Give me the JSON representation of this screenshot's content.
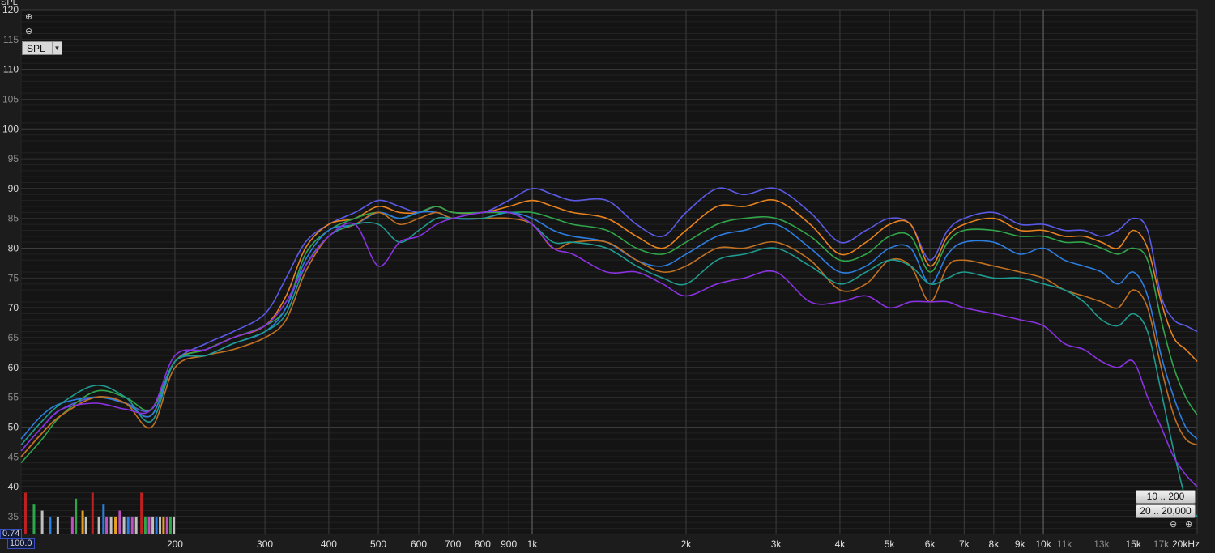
{
  "toolbar": {
    "yaxis_title": "SPL",
    "spl_select": "SPL",
    "range_freq": "10 .. 200",
    "range_span": "20 .. 20,000",
    "cursor_value": "0.74",
    "cursor_freq": "100.0",
    "zoom_in_icon": "zoom-in-icon",
    "zoom_out_icon": "zoom-out-icon"
  },
  "colors": {
    "background": "#1c1c1c",
    "plot_background": "#141414",
    "grid_major": "#3a3a3a",
    "grid_minor": "#262626"
  },
  "chart_data": {
    "type": "line",
    "title": "",
    "xlabel": "",
    "ylabel": "SPL",
    "x_scale": "log",
    "xlim": [
      100,
      20000
    ],
    "ylim": [
      32,
      120
    ],
    "grid": true,
    "legend": "none",
    "y_ticks": [
      {
        "v": 120,
        "label": "120",
        "major": true
      },
      {
        "v": 115,
        "label": "115",
        "major": false
      },
      {
        "v": 110,
        "label": "110",
        "major": true
      },
      {
        "v": 105,
        "label": "105",
        "major": false
      },
      {
        "v": 100,
        "label": "100",
        "major": true
      },
      {
        "v": 95,
        "label": "95",
        "major": false
      },
      {
        "v": 90,
        "label": "90",
        "major": true
      },
      {
        "v": 85,
        "label": "85",
        "major": false
      },
      {
        "v": 80,
        "label": "80",
        "major": true
      },
      {
        "v": 75,
        "label": "75",
        "major": false
      },
      {
        "v": 70,
        "label": "70",
        "major": true
      },
      {
        "v": 65,
        "label": "65",
        "major": false
      },
      {
        "v": 60,
        "label": "60",
        "major": true
      },
      {
        "v": 55,
        "label": "55",
        "major": false
      },
      {
        "v": 50,
        "label": "50",
        "major": true
      },
      {
        "v": 45,
        "label": "45",
        "major": false
      },
      {
        "v": 40,
        "label": "40",
        "major": true
      },
      {
        "v": 35,
        "label": "35",
        "major": false
      }
    ],
    "x_ticks": [
      {
        "v": 200,
        "label": "200",
        "major": true
      },
      {
        "v": 300,
        "label": "300",
        "major": true
      },
      {
        "v": 400,
        "label": "400",
        "major": true
      },
      {
        "v": 500,
        "label": "500",
        "major": true
      },
      {
        "v": 600,
        "label": "600",
        "major": true
      },
      {
        "v": 700,
        "label": "700",
        "major": true
      },
      {
        "v": 800,
        "label": "800",
        "major": true
      },
      {
        "v": 900,
        "label": "900",
        "major": true
      },
      {
        "v": 1000,
        "label": "1k",
        "major": true
      },
      {
        "v": 2000,
        "label": "2k",
        "major": true
      },
      {
        "v": 3000,
        "label": "3k",
        "major": true
      },
      {
        "v": 4000,
        "label": "4k",
        "major": true
      },
      {
        "v": 5000,
        "label": "5k",
        "major": true
      },
      {
        "v": 6000,
        "label": "6k",
        "major": true
      },
      {
        "v": 7000,
        "label": "7k",
        "major": true
      },
      {
        "v": 8000,
        "label": "8k",
        "major": true
      },
      {
        "v": 9000,
        "label": "9k",
        "major": true
      },
      {
        "v": 10000,
        "label": "10k",
        "major": true
      },
      {
        "v": 11000,
        "label": "11k",
        "major": false
      },
      {
        "v": 13000,
        "label": "13k",
        "major": false
      },
      {
        "v": 15000,
        "label": "15k",
        "major": true
      },
      {
        "v": 17000,
        "label": "17k",
        "major": false
      },
      {
        "v": 20000,
        "label": "20kHz",
        "major": true
      }
    ],
    "series": [
      {
        "color": "#5a5ae6",
        "x": [
          100,
          110,
          120,
          140,
          160,
          180,
          200,
          230,
          260,
          300,
          330,
          360,
          400,
          450,
          500,
          550,
          600,
          650,
          700,
          800,
          900,
          1000,
          1100,
          1200,
          1400,
          1600,
          1800,
          2000,
          2300,
          2600,
          3000,
          3500,
          4000,
          4500,
          5000,
          5500,
          6000,
          6500,
          7000,
          8000,
          9000,
          10000,
          11000,
          12000,
          13000,
          14000,
          15000,
          16000,
          17000,
          18000,
          19000,
          20000
        ],
        "y": [
          46,
          50,
          53,
          55,
          54,
          53,
          61,
          64,
          66,
          69,
          75,
          81,
          84,
          86,
          88,
          87,
          86,
          87,
          86,
          86,
          88,
          90,
          89,
          88,
          88,
          84,
          82,
          86,
          90,
          89,
          90,
          86,
          81,
          83,
          85,
          84,
          78,
          83,
          85,
          86,
          84,
          84,
          83,
          83,
          82,
          83,
          85,
          83,
          72,
          68,
          67,
          66
        ]
      },
      {
        "color": "#e8821e",
        "x": [
          100,
          110,
          120,
          140,
          160,
          180,
          200,
          230,
          260,
          300,
          330,
          360,
          400,
          450,
          500,
          550,
          600,
          650,
          700,
          800,
          900,
          1000,
          1100,
          1200,
          1400,
          1600,
          1800,
          2000,
          2300,
          2600,
          3000,
          3500,
          4000,
          4500,
          5000,
          5500,
          6000,
          6500,
          7000,
          8000,
          9000,
          10000,
          11000,
          12000,
          13000,
          14000,
          15000,
          16000,
          17000,
          18000,
          19000,
          20000
        ],
        "y": [
          45,
          49,
          52,
          55,
          54,
          52,
          61,
          63,
          65,
          67,
          72,
          80,
          84,
          85,
          87,
          86,
          86,
          87,
          86,
          86,
          87,
          88,
          87,
          86,
          85,
          82,
          80,
          83,
          87,
          87,
          88,
          84,
          79,
          81,
          84,
          84,
          77,
          82,
          84,
          85,
          83,
          83,
          82,
          82,
          81,
          80,
          83,
          80,
          71,
          65,
          63,
          61
        ]
      },
      {
        "color": "#2fa64a",
        "x": [
          100,
          110,
          120,
          140,
          160,
          180,
          200,
          230,
          260,
          300,
          330,
          360,
          400,
          450,
          500,
          550,
          600,
          650,
          700,
          800,
          900,
          1000,
          1100,
          1200,
          1400,
          1600,
          1800,
          2000,
          2300,
          2600,
          3000,
          3500,
          4000,
          4500,
          5000,
          5500,
          6000,
          6500,
          7000,
          8000,
          9000,
          10000,
          11000,
          12000,
          13000,
          14000,
          15000,
          16000,
          17000,
          18000,
          19000,
          20000
        ],
        "y": [
          44,
          48,
          52,
          56,
          55,
          53,
          61,
          63,
          65,
          67,
          70,
          79,
          83,
          85,
          86,
          85,
          86,
          87,
          86,
          86,
          86,
          86,
          85,
          84,
          83,
          80,
          79,
          81,
          84,
          85,
          85,
          82,
          78,
          79,
          82,
          82,
          76,
          81,
          83,
          83,
          82,
          82,
          81,
          81,
          80,
          79,
          80,
          78,
          68,
          60,
          55,
          52
        ]
      },
      {
        "color": "#2c7ee0",
        "x": [
          100,
          110,
          120,
          140,
          160,
          180,
          200,
          230,
          260,
          300,
          330,
          360,
          400,
          450,
          500,
          550,
          600,
          650,
          700,
          800,
          900,
          1000,
          1100,
          1200,
          1400,
          1600,
          1800,
          2000,
          2300,
          2600,
          3000,
          3500,
          4000,
          4500,
          5000,
          5500,
          6000,
          6500,
          7000,
          8000,
          9000,
          10000,
          11000,
          12000,
          13000,
          14000,
          15000,
          16000,
          17000,
          18000,
          19000,
          20000
        ],
        "y": [
          48,
          52,
          54,
          55,
          54,
          52,
          61,
          62,
          64,
          66,
          70,
          78,
          83,
          84,
          86,
          85,
          86,
          86,
          85,
          85,
          86,
          85,
          83,
          82,
          81,
          78,
          77,
          79,
          82,
          83,
          84,
          80,
          76,
          77,
          80,
          80,
          74,
          79,
          81,
          81,
          79,
          80,
          78,
          77,
          76,
          74,
          76,
          72,
          62,
          55,
          50,
          48
        ]
      },
      {
        "color": "#c07020",
        "x": [
          100,
          110,
          120,
          140,
          160,
          180,
          200,
          230,
          260,
          300,
          330,
          360,
          400,
          450,
          500,
          550,
          600,
          650,
          700,
          800,
          900,
          1000,
          1100,
          1200,
          1400,
          1600,
          1800,
          2000,
          2300,
          2600,
          3000,
          3500,
          4000,
          4500,
          5000,
          5500,
          6000,
          6500,
          7000,
          8000,
          9000,
          10000,
          11000,
          12000,
          13000,
          14000,
          15000,
          16000,
          17000,
          18000,
          19000,
          20000
        ],
        "y": [
          45,
          49,
          52,
          55,
          54,
          50,
          60,
          62,
          63,
          65,
          68,
          76,
          82,
          84,
          86,
          84,
          85,
          86,
          85,
          85,
          85,
          84,
          80,
          81,
          81,
          78,
          76,
          77,
          80,
          80,
          81,
          78,
          73,
          74,
          78,
          77,
          71,
          77,
          78,
          77,
          76,
          75,
          73,
          72,
          71,
          70,
          73,
          70,
          60,
          52,
          48,
          47
        ]
      },
      {
        "color": "#1f9b8f",
        "x": [
          100,
          110,
          120,
          140,
          160,
          180,
          200,
          230,
          260,
          300,
          330,
          360,
          400,
          450,
          500,
          550,
          600,
          650,
          700,
          800,
          900,
          1000,
          1100,
          1200,
          1400,
          1600,
          1800,
          2000,
          2300,
          2600,
          3000,
          3500,
          4000,
          4500,
          5000,
          5500,
          6000,
          6500,
          7000,
          8000,
          9000,
          10000,
          11000,
          12000,
          13000,
          14000,
          15000,
          16000,
          17000,
          18000,
          19000,
          20000
        ],
        "y": [
          47,
          51,
          54,
          57,
          55,
          51,
          61,
          62,
          64,
          66,
          69,
          77,
          82,
          84,
          84,
          81,
          83,
          85,
          85,
          85,
          86,
          84,
          81,
          81,
          80,
          77,
          75,
          74,
          78,
          79,
          80,
          77,
          74,
          76,
          78,
          77,
          74,
          75,
          76,
          75,
          75,
          74,
          73,
          71,
          68,
          67,
          69,
          66,
          56,
          46,
          38,
          35
        ]
      },
      {
        "color": "#8a32e0",
        "x": [
          100,
          110,
          120,
          140,
          160,
          180,
          200,
          230,
          260,
          300,
          330,
          360,
          400,
          450,
          500,
          550,
          600,
          650,
          700,
          800,
          900,
          1000,
          1100,
          1200,
          1400,
          1600,
          1800,
          2000,
          2300,
          2600,
          3000,
          3500,
          4000,
          4500,
          5000,
          5500,
          6000,
          6500,
          7000,
          8000,
          9000,
          10000,
          11000,
          12000,
          13000,
          14000,
          15000,
          16000,
          17000,
          18000,
          19000,
          20000
        ],
        "y": [
          46,
          50,
          53,
          54,
          53,
          53,
          62,
          63,
          65,
          67,
          71,
          77,
          82,
          84,
          77,
          81,
          82,
          84,
          85,
          86,
          86,
          84,
          80,
          79,
          76,
          76,
          74,
          72,
          74,
          75,
          76,
          71,
          71,
          72,
          70,
          71,
          71,
          71,
          70,
          69,
          68,
          67,
          64,
          63,
          61,
          60,
          61,
          55,
          50,
          45,
          42,
          40
        ]
      }
    ],
    "bars_note": "",
    "bars": [
      {
        "x": 102,
        "h": 39,
        "color": "#c02020"
      },
      {
        "x": 106,
        "h": 37,
        "color": "#2fa64a"
      },
      {
        "x": 110,
        "h": 36,
        "color": "#c0c0c0"
      },
      {
        "x": 114,
        "h": 35,
        "color": "#2c7ee0"
      },
      {
        "x": 118,
        "h": 35,
        "color": "#c0c0c0"
      },
      {
        "x": 126,
        "h": 35,
        "color": "#c050c0"
      },
      {
        "x": 128,
        "h": 38,
        "color": "#2fa64a"
      },
      {
        "x": 132,
        "h": 36,
        "color": "#e8a020"
      },
      {
        "x": 134,
        "h": 35,
        "color": "#c0c0c0"
      },
      {
        "x": 138,
        "h": 39,
        "color": "#c02020"
      },
      {
        "x": 142,
        "h": 35,
        "color": "#c0c0c0"
      },
      {
        "x": 145,
        "h": 37,
        "color": "#2c7ee0"
      },
      {
        "x": 147,
        "h": 35,
        "color": "#c050c0"
      },
      {
        "x": 150,
        "h": 35,
        "color": "#c0c0c0"
      },
      {
        "x": 153,
        "h": 35,
        "color": "#e8a020"
      },
      {
        "x": 156,
        "h": 36,
        "color": "#c050c0"
      },
      {
        "x": 159,
        "h": 35,
        "color": "#c0c0c0"
      },
      {
        "x": 162,
        "h": 35,
        "color": "#2c7ee0"
      },
      {
        "x": 165,
        "h": 35,
        "color": "#c050c0"
      },
      {
        "x": 168,
        "h": 35,
        "color": "#c0c0c0"
      },
      {
        "x": 172,
        "h": 39,
        "color": "#c02020"
      },
      {
        "x": 175,
        "h": 35,
        "color": "#2fa64a"
      },
      {
        "x": 178,
        "h": 35,
        "color": "#c050c0"
      },
      {
        "x": 181,
        "h": 35,
        "color": "#c0c0c0"
      },
      {
        "x": 184,
        "h": 35,
        "color": "#2c7ee0"
      },
      {
        "x": 187,
        "h": 35,
        "color": "#c0c0c0"
      },
      {
        "x": 190,
        "h": 35,
        "color": "#e8a020"
      },
      {
        "x": 193,
        "h": 35,
        "color": "#c050c0"
      },
      {
        "x": 196,
        "h": 35,
        "color": "#2fa64a"
      },
      {
        "x": 199,
        "h": 35,
        "color": "#c0c0c0"
      }
    ]
  }
}
